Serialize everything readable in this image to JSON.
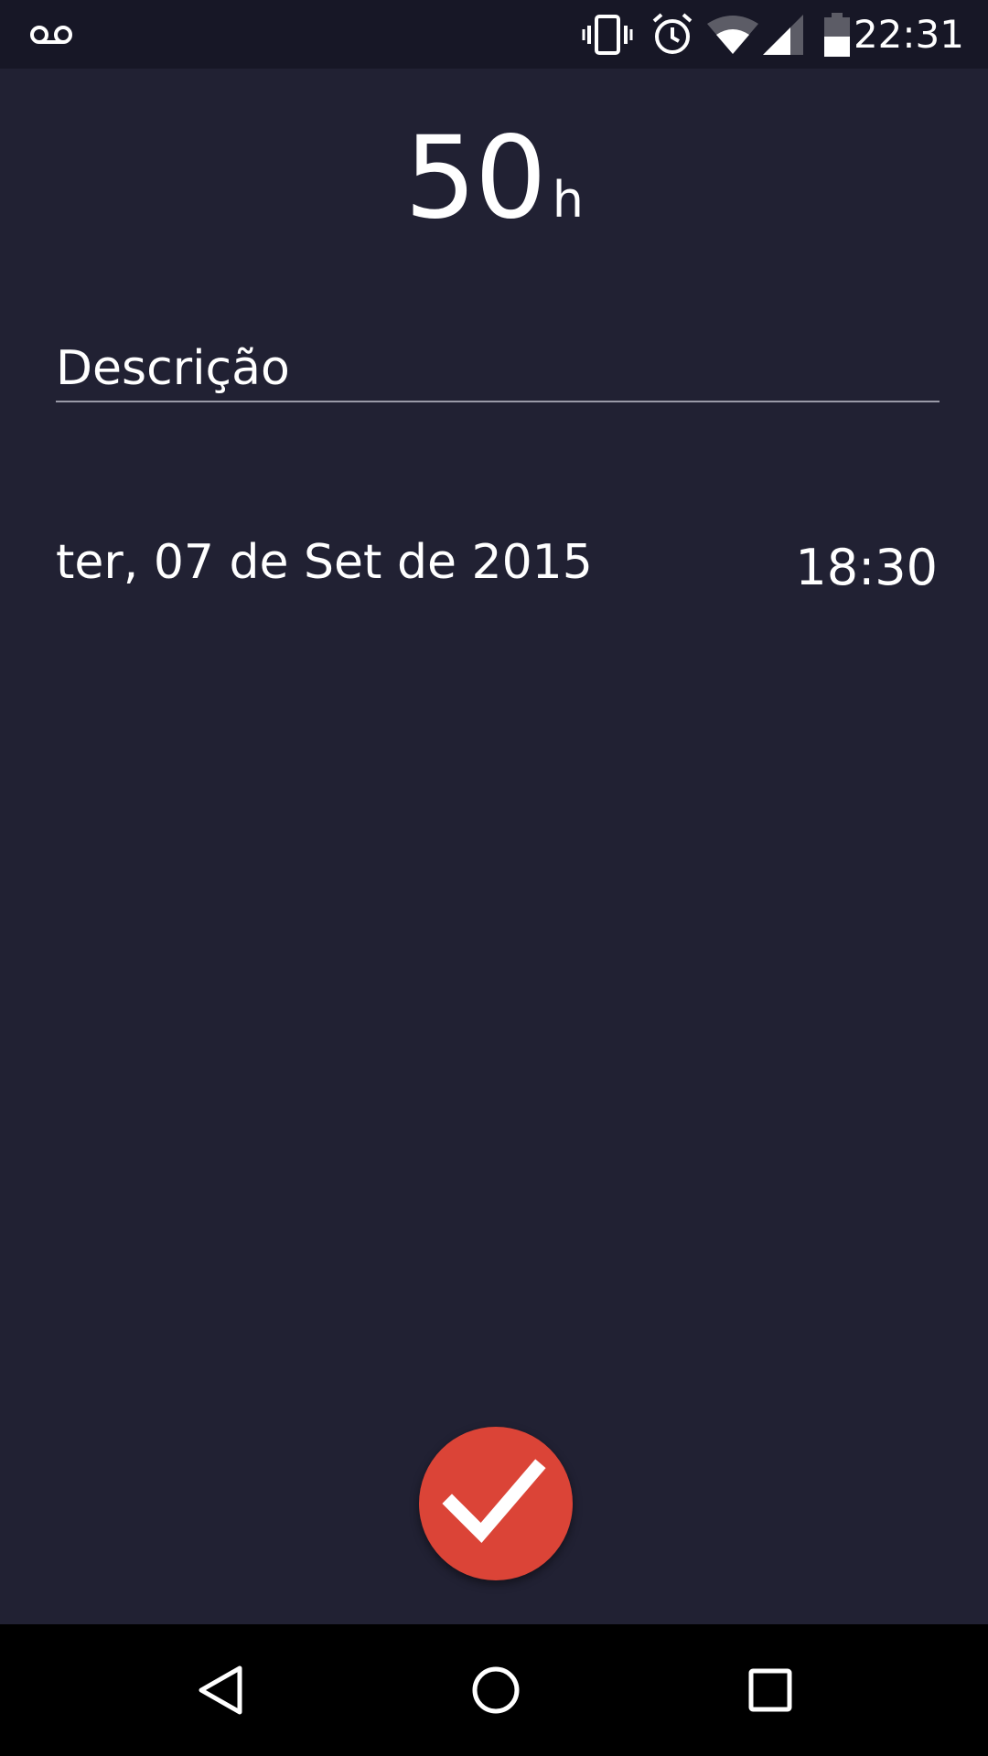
{
  "status_bar": {
    "time": "22:31",
    "icons": [
      "voicemail-icon",
      "vibrate-icon",
      "alarm-icon",
      "wifi-icon",
      "signal-icon",
      "battery-icon"
    ]
  },
  "hours": {
    "value": "50",
    "unit": "h"
  },
  "description": {
    "placeholder": "Descrição"
  },
  "date": {
    "label": "ter, 07 de Set de 2015"
  },
  "time": {
    "label": "18:30"
  },
  "confirm_button": {
    "icon": "check-icon",
    "color": "#db4437"
  },
  "nav_bar": {
    "icons": [
      "back-icon",
      "home-icon",
      "recents-icon"
    ]
  },
  "colors": {
    "background": "#212133",
    "status_bar": "#171726",
    "accent": "#db4437"
  }
}
